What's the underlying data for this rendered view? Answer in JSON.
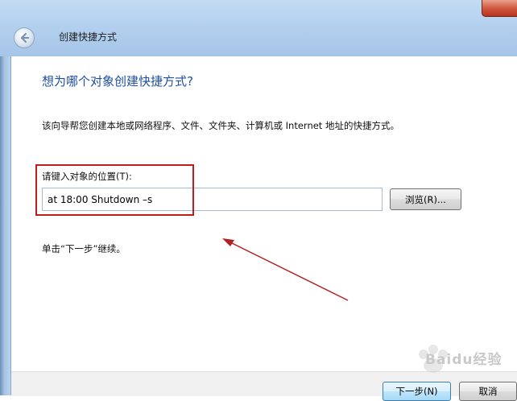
{
  "window": {
    "title": "创建快捷方式"
  },
  "page": {
    "heading": "想为哪个对象创建快捷方式?",
    "description": "该向导帮您创建本地或网络程序、文件、文件夹、计算机或 Internet 地址的快捷方式。",
    "location_label": "请键入对象的位置(T):",
    "location_value": "at 18:00 Shutdown –s",
    "browse_label": "浏览(R)...",
    "hint": "单击“下一步”继续。"
  },
  "footer": {
    "next_label": "下一步(N)",
    "cancel_label": "取消"
  },
  "annotation": {
    "highlight_color": "#c01c1c",
    "arrow_color": "#b02020"
  },
  "watermark": {
    "text": "Baidu经验"
  },
  "colors": {
    "heading": "#1f4fa3",
    "titlebar": "#b3d0ee"
  }
}
